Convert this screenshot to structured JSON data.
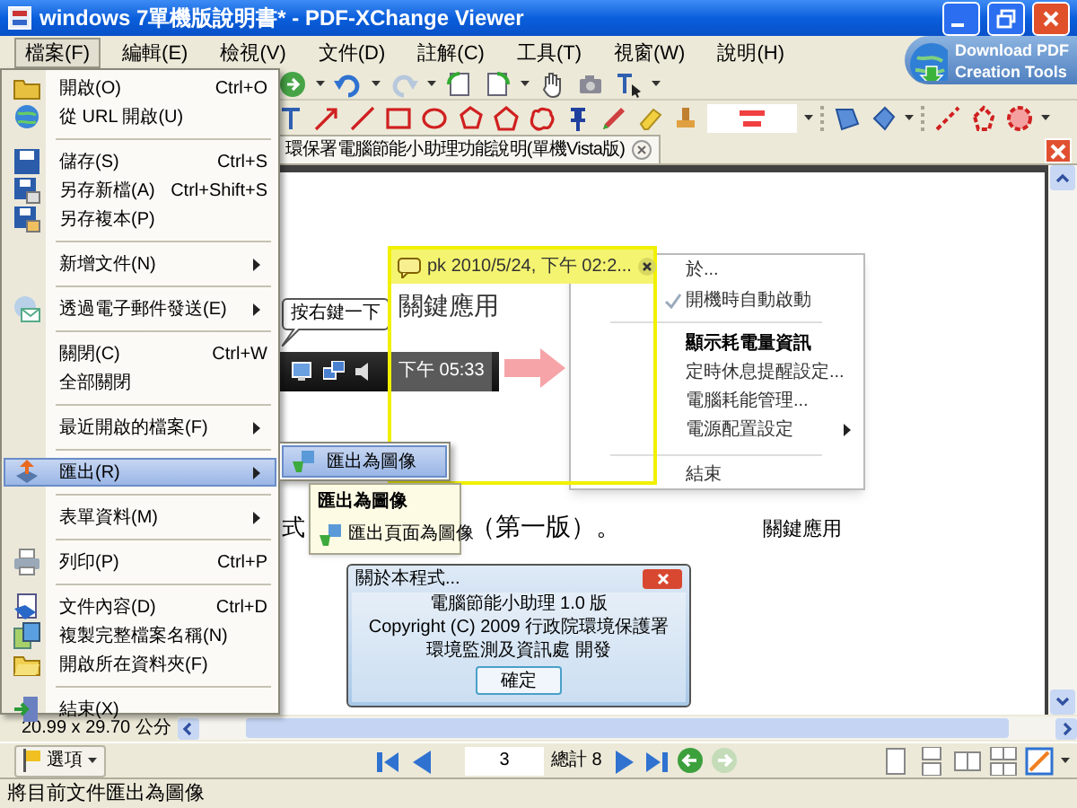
{
  "window": {
    "title": "windows 7單機版說明書* - PDF-XChange Viewer"
  },
  "menu_bar": [
    {
      "label": "檔案(F)",
      "selected": true
    },
    {
      "label": "編輯(E)",
      "selected": false
    },
    {
      "label": "檢視(V)",
      "selected": false
    },
    {
      "label": "文件(D)",
      "selected": false
    },
    {
      "label": "註解(C)",
      "selected": false
    },
    {
      "label": "工具(T)",
      "selected": false
    },
    {
      "label": "視窗(W)",
      "selected": false
    },
    {
      "label": "說明(H)",
      "selected": false
    }
  ],
  "promo": {
    "lines": [
      "Download PDF",
      "Creation Tools"
    ]
  },
  "document_tab": {
    "title": "環保署電腦節能小助理功能說明(單機Vista版)"
  },
  "document": {
    "callout": "按右鍵一下",
    "taskbar_time": "下午 05:33",
    "context_menu": [
      {
        "label": "於...",
        "checked": false,
        "bold": false,
        "submenu": false
      },
      {
        "label": "開機時自動啟動",
        "checked": true,
        "bold": false,
        "submenu": false
      },
      {
        "label": "顯示耗電量資訊",
        "checked": false,
        "bold": true,
        "submenu": false
      },
      {
        "label": "定時休息提醒設定...",
        "checked": false,
        "bold": false,
        "submenu": false
      },
      {
        "label": "電腦耗能管理...",
        "checked": false,
        "bold": false,
        "submenu": false
      },
      {
        "label": "電源配置設定",
        "checked": false,
        "bold": false,
        "submenu": true
      },
      {
        "label": "結束",
        "checked": false,
        "bold": false,
        "submenu": false
      }
    ],
    "body_text_start": "式",
    "body_text_end": "（第一版）。",
    "caption": "關鍵應用",
    "about_dialog": {
      "title": "關於本程式...",
      "lines": [
        "電腦節能小助理 1.0 版",
        "Copyright (C) 2009 行政院環境保護署",
        "環境監測及資訊處 開發"
      ],
      "button": "確定"
    }
  },
  "note": {
    "header": "pk 2010/5/24, 下午 02:2...",
    "text": "關鍵應用"
  },
  "file_menu": [
    {
      "kind": "item",
      "label": "開啟(O)",
      "shortcut": "Ctrl+O",
      "submenu": false,
      "icon": true,
      "selected": false
    },
    {
      "kind": "item",
      "label": "從 URL 開啟(U)",
      "submenu": false,
      "icon": true,
      "selected": false
    },
    {
      "kind": "separator"
    },
    {
      "kind": "item",
      "label": "儲存(S)",
      "shortcut": "Ctrl+S",
      "submenu": false,
      "icon": true,
      "selected": false
    },
    {
      "kind": "item",
      "label": "另存新檔(A)",
      "shortcut": "Ctrl+Shift+S",
      "submenu": false,
      "icon": true,
      "selected": false
    },
    {
      "kind": "item",
      "label": "另存複本(P)",
      "submenu": false,
      "icon": true,
      "selected": false
    },
    {
      "kind": "separator"
    },
    {
      "kind": "item",
      "label": "新增文件(N)",
      "submenu": true,
      "icon": false,
      "selected": false
    },
    {
      "kind": "separator"
    },
    {
      "kind": "item",
      "label": "透過電子郵件發送(E)",
      "submenu": true,
      "icon": true,
      "selected": false
    },
    {
      "kind": "separator"
    },
    {
      "kind": "item",
      "label": "關閉(C)",
      "shortcut": "Ctrl+W",
      "submenu": false,
      "icon": false,
      "selected": false
    },
    {
      "kind": "item",
      "label": "全部關閉",
      "submenu": false,
      "icon": false,
      "selected": false
    },
    {
      "kind": "separator"
    },
    {
      "kind": "item",
      "label": "最近開啟的檔案(F)",
      "submenu": true,
      "icon": false,
      "selected": false
    },
    {
      "kind": "separator"
    },
    {
      "kind": "item",
      "label": "匯出(R)",
      "submenu": true,
      "icon": true,
      "selected": true
    },
    {
      "kind": "separator"
    },
    {
      "kind": "item",
      "label": "表單資料(M)",
      "submenu": true,
      "icon": false,
      "selected": false
    },
    {
      "kind": "separator"
    },
    {
      "kind": "item",
      "label": "列印(P)",
      "shortcut": "Ctrl+P",
      "submenu": false,
      "icon": true,
      "selected": false
    },
    {
      "kind": "separator"
    },
    {
      "kind": "item",
      "label": "文件內容(D)",
      "shortcut": "Ctrl+D",
      "submenu": false,
      "icon": true,
      "selected": false
    },
    {
      "kind": "item",
      "label": "複製完整檔案名稱(N)",
      "submenu": false,
      "icon": true,
      "selected": false
    },
    {
      "kind": "item",
      "label": "開啟所在資料夾(F)",
      "submenu": false,
      "icon": true,
      "selected": false
    },
    {
      "kind": "separator"
    },
    {
      "kind": "item",
      "label": "結束(X)",
      "submenu": false,
      "icon": true,
      "selected": false
    }
  ],
  "submenu": [
    {
      "label": "匯出為圖像",
      "selected": true
    }
  ],
  "tooltip": {
    "title": "匯出為圖像",
    "item": "匯出頁面為圖像"
  },
  "page_size": "20.99 x 29.70 公分",
  "navigation": {
    "options": "選項",
    "page": "3",
    "total": "總計 8",
    "forward_disabled": true
  },
  "status_bar": "將目前文件匯出為圖像"
}
